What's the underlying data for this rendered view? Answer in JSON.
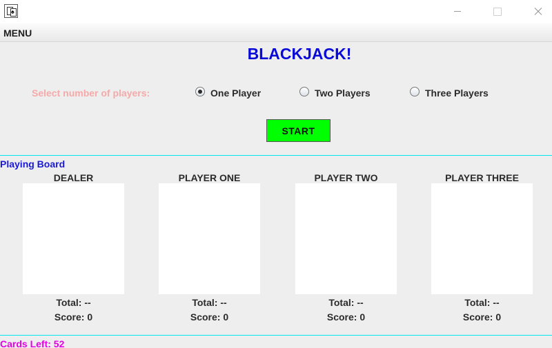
{
  "menu": {
    "label": "MENU"
  },
  "title": "BLACKJACK!",
  "player_select": {
    "label": "Select number of players:",
    "options": [
      {
        "label": "One Player",
        "selected": true
      },
      {
        "label": "Two Players",
        "selected": false
      },
      {
        "label": "Three Players",
        "selected": false
      }
    ]
  },
  "start_label": "START",
  "board": {
    "label": "Playing Board",
    "hands": [
      {
        "name": "DEALER",
        "total": "Total: --",
        "score": "Score: 0"
      },
      {
        "name": "PLAYER ONE",
        "total": "Total: --",
        "score": "Score: 0"
      },
      {
        "name": "PLAYER TWO",
        "total": "Total: --",
        "score": "Score: 0"
      },
      {
        "name": "PLAYER THREE",
        "total": "Total: --",
        "score": "Score: 0"
      }
    ]
  },
  "cards_left": "Cards Left: 52",
  "colors": {
    "title": "#0a0ad8",
    "select_label": "#f5a9a9",
    "start_button": "#00ff00",
    "board_label": "#1a1ad6",
    "board_divider": "#00e5ee",
    "cards_left": "#e600e6",
    "card_area": "#ffffff",
    "background": "#eeeeee"
  },
  "icons": [
    "app-card-icon",
    "minimize-icon",
    "maximize-icon",
    "close-icon"
  ]
}
